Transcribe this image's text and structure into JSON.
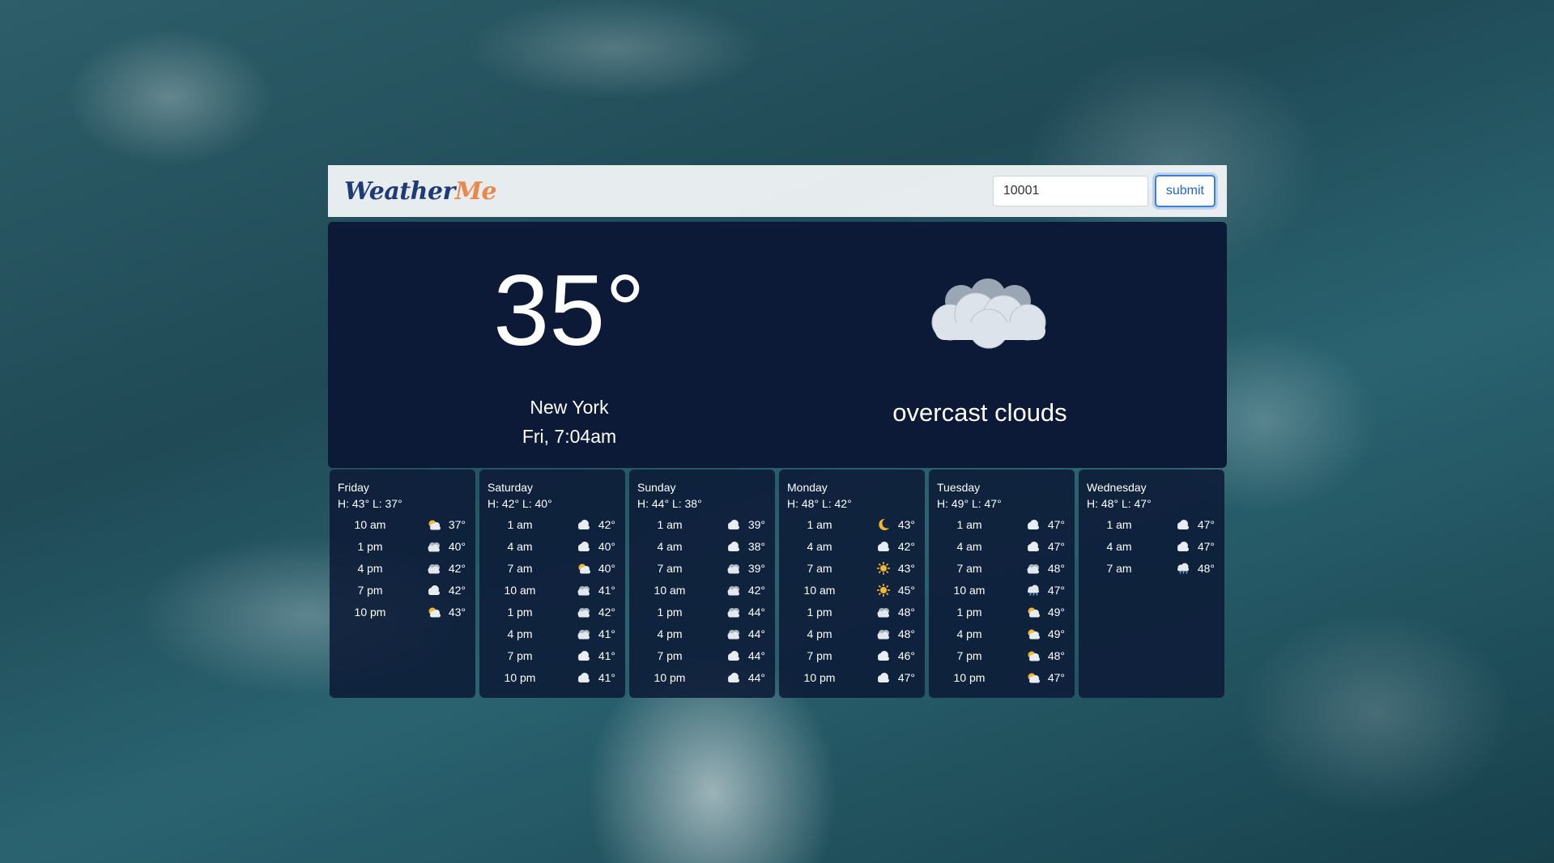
{
  "brand": {
    "part1": "Weather",
    "part2": "Me"
  },
  "search": {
    "value": "10001",
    "button_label": "submit"
  },
  "current": {
    "temp": "35°",
    "city": "New York",
    "time": "Fri, 7:04am",
    "description": "overcast clouds",
    "icon": "overcast-clouds-icon"
  },
  "forecast": [
    {
      "day": "Friday",
      "hl": "H: 43° L: 37°",
      "hours": [
        {
          "time": "10 am",
          "icon": "partly-cloudy",
          "temp": "37°"
        },
        {
          "time": "1 pm",
          "icon": "overcast",
          "temp": "40°"
        },
        {
          "time": "4 pm",
          "icon": "overcast",
          "temp": "42°"
        },
        {
          "time": "7 pm",
          "icon": "cloud",
          "temp": "42°"
        },
        {
          "time": "10 pm",
          "icon": "partly-cloudy",
          "temp": "43°"
        }
      ]
    },
    {
      "day": "Saturday",
      "hl": "H: 42° L: 40°",
      "hours": [
        {
          "time": "1 am",
          "icon": "cloud",
          "temp": "42°"
        },
        {
          "time": "4 am",
          "icon": "cloud",
          "temp": "40°"
        },
        {
          "time": "7 am",
          "icon": "partly-cloudy",
          "temp": "40°"
        },
        {
          "time": "10 am",
          "icon": "overcast",
          "temp": "41°"
        },
        {
          "time": "1 pm",
          "icon": "overcast",
          "temp": "42°"
        },
        {
          "time": "4 pm",
          "icon": "overcast",
          "temp": "41°"
        },
        {
          "time": "7 pm",
          "icon": "cloud",
          "temp": "41°"
        },
        {
          "time": "10 pm",
          "icon": "cloud",
          "temp": "41°"
        }
      ]
    },
    {
      "day": "Sunday",
      "hl": "H: 44° L: 38°",
      "hours": [
        {
          "time": "1 am",
          "icon": "cloud",
          "temp": "39°"
        },
        {
          "time": "4 am",
          "icon": "cloud",
          "temp": "38°"
        },
        {
          "time": "7 am",
          "icon": "overcast",
          "temp": "39°"
        },
        {
          "time": "10 am",
          "icon": "overcast",
          "temp": "42°"
        },
        {
          "time": "1 pm",
          "icon": "overcast",
          "temp": "44°"
        },
        {
          "time": "4 pm",
          "icon": "overcast",
          "temp": "44°"
        },
        {
          "time": "7 pm",
          "icon": "cloud",
          "temp": "44°"
        },
        {
          "time": "10 pm",
          "icon": "cloud",
          "temp": "44°"
        }
      ]
    },
    {
      "day": "Monday",
      "hl": "H: 48° L: 42°",
      "hours": [
        {
          "time": "1 am",
          "icon": "moon",
          "temp": "43°"
        },
        {
          "time": "4 am",
          "icon": "cloud",
          "temp": "42°"
        },
        {
          "time": "7 am",
          "icon": "sun",
          "temp": "43°"
        },
        {
          "time": "10 am",
          "icon": "sun",
          "temp": "45°"
        },
        {
          "time": "1 pm",
          "icon": "overcast",
          "temp": "48°"
        },
        {
          "time": "4 pm",
          "icon": "overcast",
          "temp": "48°"
        },
        {
          "time": "7 pm",
          "icon": "cloud",
          "temp": "46°"
        },
        {
          "time": "10 pm",
          "icon": "cloud",
          "temp": "47°"
        }
      ]
    },
    {
      "day": "Tuesday",
      "hl": "H: 49° L: 47°",
      "hours": [
        {
          "time": "1 am",
          "icon": "cloud",
          "temp": "47°"
        },
        {
          "time": "4 am",
          "icon": "cloud",
          "temp": "47°"
        },
        {
          "time": "7 am",
          "icon": "overcast",
          "temp": "48°"
        },
        {
          "time": "10 am",
          "icon": "rain",
          "temp": "47°"
        },
        {
          "time": "1 pm",
          "icon": "partly-cloudy",
          "temp": "49°"
        },
        {
          "time": "4 pm",
          "icon": "partly-cloudy",
          "temp": "49°"
        },
        {
          "time": "7 pm",
          "icon": "partly-cloudy",
          "temp": "48°"
        },
        {
          "time": "10 pm",
          "icon": "partly-cloudy",
          "temp": "47°"
        }
      ]
    },
    {
      "day": "Wednesday",
      "hl": "H: 48° L: 47°",
      "hours": [
        {
          "time": "1 am",
          "icon": "cloud",
          "temp": "47°"
        },
        {
          "time": "4 am",
          "icon": "cloud",
          "temp": "47°"
        },
        {
          "time": "7 am",
          "icon": "rain",
          "temp": "48°"
        }
      ]
    }
  ]
}
